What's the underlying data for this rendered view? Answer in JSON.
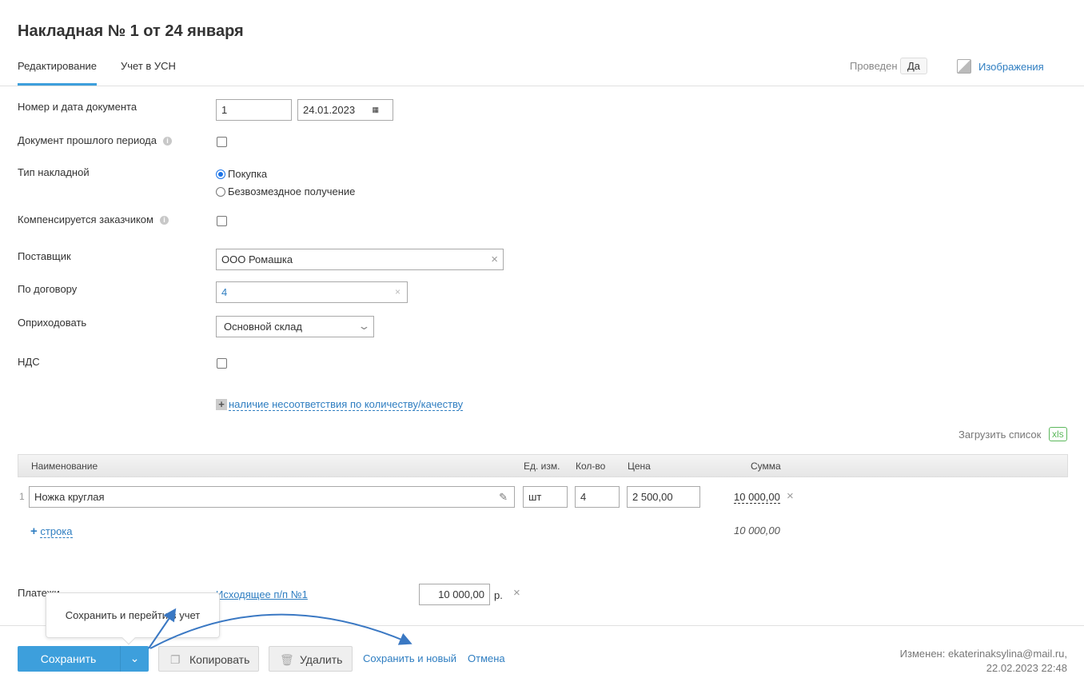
{
  "title": "Накладная № 1 от 24 января",
  "tabs": [
    {
      "label": "Редактирование",
      "active": true
    },
    {
      "label": "Учет в УСН",
      "active": false
    }
  ],
  "header": {
    "posted_label": "Проведен",
    "posted_value": "Да",
    "images_label": "Изображения"
  },
  "form": {
    "doc_number_label": "Номер и дата документа",
    "doc_number": "1",
    "doc_date": "24.01.2023",
    "past_period_label": "Документ прошлого периода",
    "past_period": false,
    "type_label": "Тип накладной",
    "type_options": [
      {
        "label": "Покупка",
        "selected": true
      },
      {
        "label": "Безвозмездное получение",
        "selected": false
      }
    ],
    "compensated_label": "Компенсируется заказчиком",
    "compensated": false,
    "supplier_label": "Поставщик",
    "supplier": "ООО Ромашка",
    "contract_label": "По договору",
    "contract": "4",
    "warehouse_label": "Оприходовать",
    "warehouse": "Основной склад",
    "vat_label": "НДС",
    "vat": false,
    "mismatch_link": "наличие несоответствия по количеству/качеству"
  },
  "upload": {
    "label": "Загрузить список",
    "badge": "xls"
  },
  "table": {
    "columns": [
      "Наименование",
      "Ед. изм.",
      "Кол-во",
      "Цена",
      "Сумма"
    ],
    "rows": [
      {
        "num": "1",
        "name": "Ножка круглая",
        "unit": "шт",
        "qty": "4",
        "price": "2 500,00",
        "sum": "10 000,00"
      }
    ],
    "add_row": "строка",
    "total": "10 000,00"
  },
  "payments": {
    "label": "Платежи",
    "link": "Исходящее п/п №1",
    "amount": "10 000,00",
    "currency": "р."
  },
  "tooltip": "Сохранить и перейти в учет",
  "footer": {
    "save": "Сохранить",
    "copy": "Копировать",
    "delete": "Удалить",
    "save_new": "Сохранить и новый",
    "cancel": "Отмена",
    "modified_line1": "Изменен: ekaterinaksylina@mail.ru,",
    "modified_line2": "22.02.2023 22:48"
  },
  "colors": {
    "accent": "#3d9fdc",
    "link": "#2f7ec1"
  }
}
